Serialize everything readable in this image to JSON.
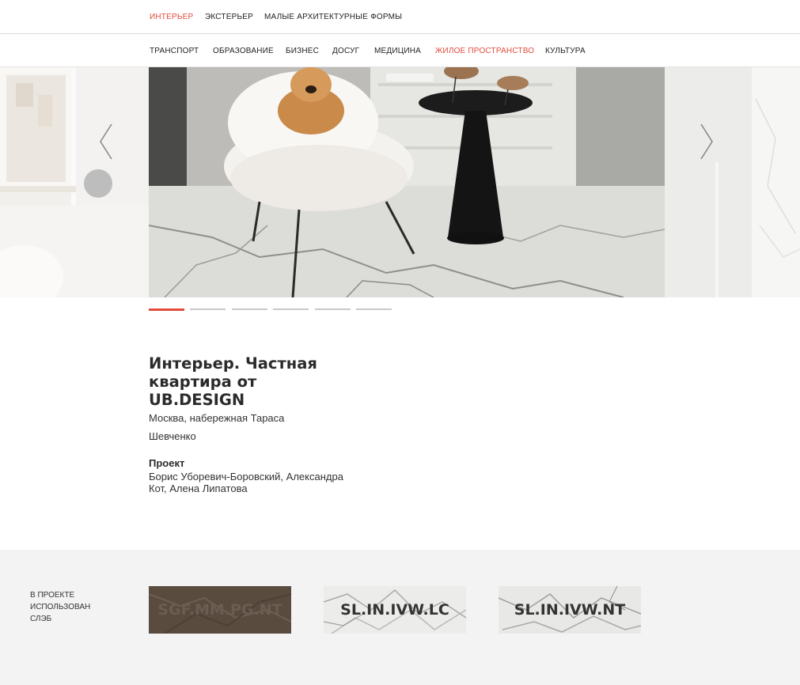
{
  "nav_primary": {
    "items": [
      {
        "label": "ИНТЕРЬЕР",
        "active": true
      },
      {
        "label": "ЭКСТЕРЬЕР",
        "active": false
      },
      {
        "label": "МАЛЫЕ АРХИТЕКТУРНЫЕ ФОРМЫ",
        "active": false
      }
    ]
  },
  "nav_secondary": {
    "items": [
      {
        "label": "ТРАНСПОРТ",
        "active": false
      },
      {
        "label": "ОБРАЗОВАНИЕ",
        "active": false
      },
      {
        "label": "БИЗНЕС",
        "active": false
      },
      {
        "label": "ДОСУГ",
        "active": false
      },
      {
        "label": "МЕДИЦИНА",
        "active": false
      },
      {
        "label": "ЖИЛОЕ ПРОСТРАНСТВО",
        "active": true
      },
      {
        "label": "КУЛЬТУРА",
        "active": false
      }
    ]
  },
  "carousel": {
    "slide_count": 6,
    "active_index": 0,
    "prev_icon": "chevron-left-icon",
    "next_icon": "chevron-right-icon"
  },
  "project": {
    "title": "Интерьер. Частная квартира от UB.DESIGN",
    "location": "Москва, набережная Тараса Шевченко",
    "label": "Проект",
    "authors": "Борис Уборевич-Боровский, Александра Кот, Алена Липатова"
  },
  "slabs": {
    "label": "В ПРОЕКТЕ ИСПОЛЬЗОВАН СЛЭБ",
    "items": [
      {
        "code": "SGF.MM.PG.NT"
      },
      {
        "code": "SL.IN.IVW.LC"
      },
      {
        "code": "SL.IN.IVW.NT"
      }
    ]
  },
  "colors": {
    "accent": "#e24b3b",
    "band": "#f3f3f3"
  }
}
